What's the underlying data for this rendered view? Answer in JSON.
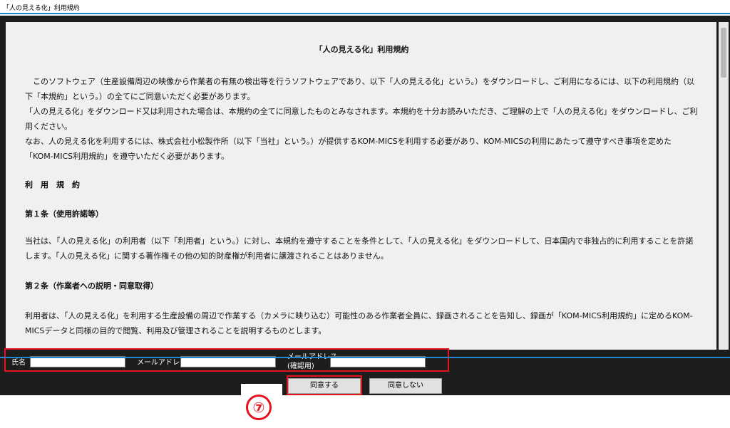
{
  "window": {
    "title": "「人の見える化」利用規約"
  },
  "document": {
    "title": "「人の見える化」利用規約",
    "intro": [
      "　このソフトウェア（生産設備周辺の映像から作業者の有無の検出等を行うソフトウェアであり、以下「人の見える化」という。）をダウンロードし、ご利用になるには、以下の利用規約（以下「本規約」という。）の全てにご同意いただく必要があります。",
      "「人の見える化」をダウンロード又は利用された場合は、本規約の全てに同意したものとみなされます。本規約を十分お読みいただき、ご理解の上で「人の見える化」をダウンロードし、ご利用ください。",
      "なお、人の見える化を利用するには、株式会社小松製作所（以下「当社」という。）が提供するKOM-MICSを利用する必要があり、KOM-MICSの利用にあたって遵守すべき事項を定めた「KOM-MICS利用規約」を遵守いただく必要があります。"
    ],
    "section_heading": "利　用　規　約",
    "articles": [
      {
        "heading": "第１条（使用許諾等）",
        "body": "当社は、「人の見える化」の利用者（以下「利用者」という。）に対し、本規約を遵守することを条件として、「人の見える化」をダウンロードして、日本国内で非独占的に利用することを許諾します。「人の見える化」に関する著作権その他の知的財産権が利用者に譲渡されることはありません。"
      },
      {
        "heading": "第２条（作業者への説明・同意取得）",
        "body": "利用者は、「人の見える化」を利用する生産設備の周辺で作業する（カメラに映り込む）可能性のある作業者全員に、録画されることを告知し、録画が「KOM-MICS利用規約」に定めるKOM-MICSデータと同様の目的で閲覧、利用及び管理されることを説明するものとします。"
      }
    ]
  },
  "form": {
    "name_label": "氏名",
    "name_value": "",
    "email_label": "メールアドレス",
    "email_value": "",
    "email_confirm_label_line1": "メールアドレス",
    "email_confirm_label_line2": "(確認用)",
    "email_confirm_value": ""
  },
  "buttons": {
    "agree": "同意する",
    "disagree": "同意しない"
  },
  "annotation": {
    "step_marker": "⑦"
  },
  "colors": {
    "accent_blue": "#1e88d2",
    "highlight_red": "#e3141b",
    "panel_dark": "#1d1d1d",
    "document_bg": "#f0f0f0"
  }
}
